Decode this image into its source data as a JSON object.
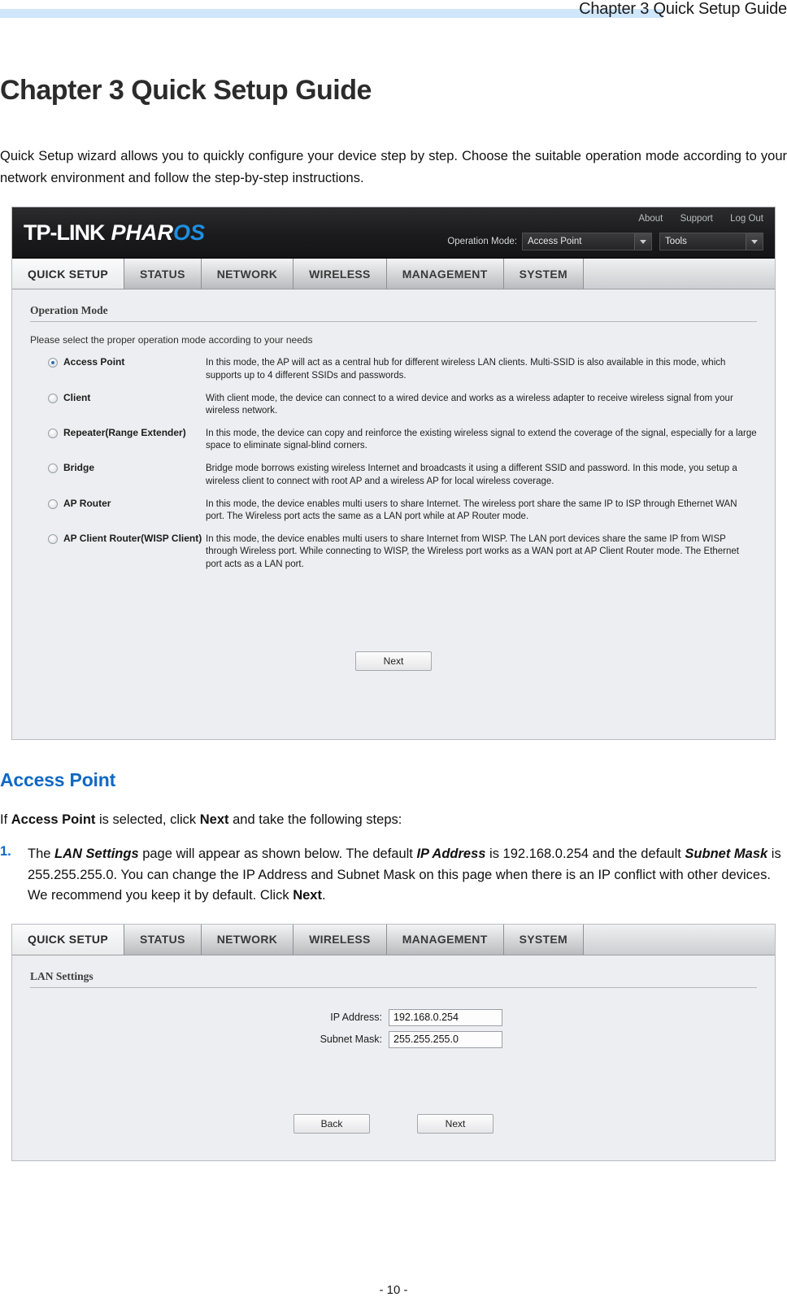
{
  "header": {
    "running_title": "Chapter 3 Quick Setup Guide"
  },
  "chapter": {
    "title": "Chapter 3   Quick Setup Guide",
    "intro": "Quick Setup wizard allows you to quickly configure your device step by step. Choose the suitable operation mode according to your network environment and follow the step-by-step instructions."
  },
  "ui": {
    "brand": {
      "tplink": "TP-LINK",
      "pharos_main": "PHAR",
      "pharos_accent": "OS"
    },
    "top_links": [
      "About",
      "Support",
      "Log Out"
    ],
    "operation_mode_label": "Operation Mode:",
    "operation_mode_value": "Access Point",
    "tools_value": "Tools",
    "tabs": [
      "QUICK SETUP",
      "STATUS",
      "NETWORK",
      "WIRELESS",
      "MANAGEMENT",
      "SYSTEM"
    ],
    "active_tab": "QUICK SETUP"
  },
  "operation_mode_panel": {
    "title": "Operation Mode",
    "hint": "Please select the proper operation mode according to your needs",
    "modes": [
      {
        "name": "Access Point",
        "selected": true,
        "desc": "In this mode, the AP will act as a central hub for different wireless LAN clients. Multi-SSID is also available in this mode, which supports up to 4 different SSIDs and passwords."
      },
      {
        "name": "Client",
        "selected": false,
        "desc": "With client mode, the device can connect to a wired device and works as a wireless adapter to receive wireless signal from your wireless network."
      },
      {
        "name": "Repeater(Range Extender)",
        "selected": false,
        "desc": "In this mode, the device can copy and reinforce the existing wireless signal to extend the coverage of the signal, especially for a large space to eliminate signal-blind corners."
      },
      {
        "name": "Bridge",
        "selected": false,
        "desc": "Bridge mode borrows existing wireless Internet and broadcasts it using a different SSID and password. In this mode, you setup a wireless client to connect with root AP and a wireless AP for local wireless coverage."
      },
      {
        "name": "AP Router",
        "selected": false,
        "desc": "In this mode, the device enables multi users to share Internet. The wireless port share the same IP to ISP through Ethernet WAN port. The Wireless port acts the same as a LAN port while at AP Router mode."
      },
      {
        "name": "AP Client Router(WISP Client)",
        "selected": false,
        "desc": "In this mode, the device enables multi users to share Internet from WISP. The LAN port devices share the same IP from WISP through Wireless port. While connecting to WISP, the Wireless port works as a WAN port at AP Client Router mode. The Ethernet port acts as a LAN port."
      }
    ],
    "next_button": "Next"
  },
  "access_point_section": {
    "heading": "Access Point",
    "lead_prefix": "If ",
    "lead_bold1": "Access Point",
    "lead_mid": " is selected, click ",
    "lead_bold2": "Next",
    "lead_suffix": " and take the following steps:",
    "step1_number": "1.",
    "step1_t1": "The ",
    "step1_i1": "LAN Settings",
    "step1_t2": " page will appear as shown below. The default ",
    "step1_i2": "IP Address",
    "step1_t3": " is 192.168.0.254 and the default ",
    "step1_i3": "Subnet Mask",
    "step1_t4": " is 255.255.255.0. You can change the IP Address and Subnet Mask on this page when there is an IP conflict with other devices. We recommend you keep it by default. Click ",
    "step1_b1": "Next",
    "step1_t5": "."
  },
  "lan_settings_panel": {
    "title": "LAN Settings",
    "ip_label": "IP Address:",
    "ip_value": "192.168.0.254",
    "subnet_label": "Subnet Mask:",
    "subnet_value": "255.255.255.0",
    "back_button": "Back",
    "next_button": "Next"
  },
  "footer": {
    "page_number": "- 10 -"
  },
  "colors": {
    "header_rule": "#cfe6fb",
    "heading_blue": "#1068c4",
    "brand_accent": "#1f8fe0"
  }
}
